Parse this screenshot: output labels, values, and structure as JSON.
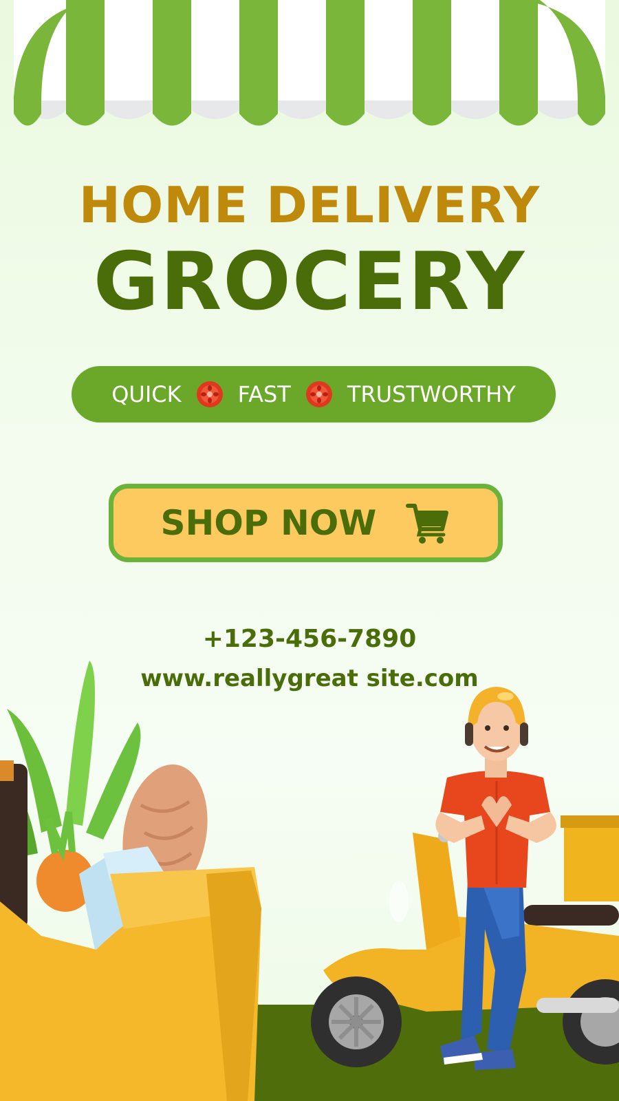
{
  "header": {
    "line1": "HOME DELIVERY",
    "line2": "GROCERY"
  },
  "tagline": {
    "items": [
      "QUICK",
      "FAST",
      "TRUSTWORTHY"
    ],
    "separator_icon": "tomato-icon"
  },
  "cta": {
    "label": "SHOP NOW",
    "icon": "cart-icon"
  },
  "contact": {
    "phone": "+123-456-7890",
    "website": "www.reallygreat site.com"
  },
  "colors": {
    "accent_gold": "#bf8a0b",
    "brand_green": "#4a6d0a",
    "pill_green": "#6ba82a",
    "button_yellow": "#fdca60"
  }
}
